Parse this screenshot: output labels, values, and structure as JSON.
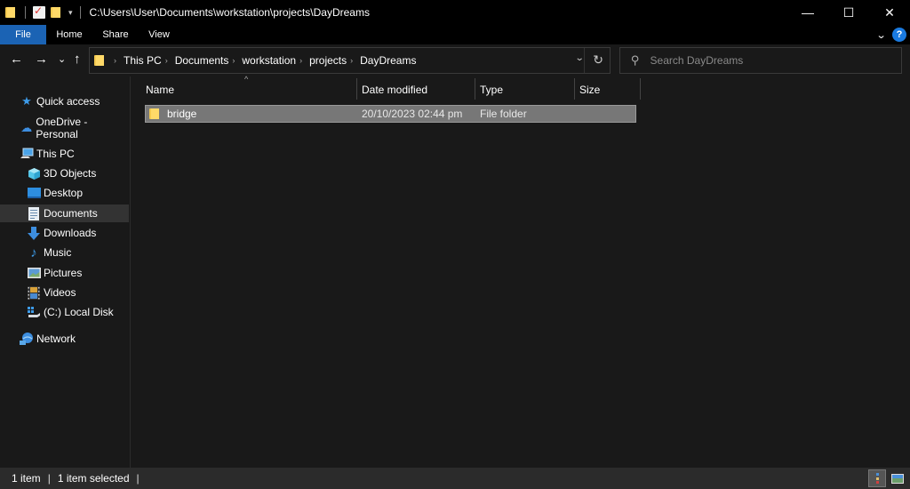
{
  "window": {
    "title": "C:\\Users\\User\\Documents\\workstation\\projects\\DayDreams",
    "controls": {
      "minimize": "—",
      "maximize": "☐",
      "close": "✕"
    }
  },
  "quick_access_toolbar": {
    "icons": [
      "folder-icon",
      "properties-icon",
      "new-folder-icon",
      "customize-dropdown-icon"
    ],
    "dropdown_glyph": "▾"
  },
  "ribbon": {
    "tabs": [
      {
        "label": "File",
        "active": true
      },
      {
        "label": "Home"
      },
      {
        "label": "Share"
      },
      {
        "label": "View"
      }
    ],
    "expand_glyph": "⌄",
    "help_glyph": "?",
    "file_tab_color": "#1b63b4"
  },
  "navigation": {
    "back_glyph": "←",
    "forward_glyph": "→",
    "recent_glyph": "⌄",
    "up_glyph": "↑",
    "breadcrumb": [
      "This PC",
      "Documents",
      "workstation",
      "projects",
      "DayDreams"
    ],
    "crumb_separator": "›",
    "dropdown_glyph": "⌄",
    "refresh_glyph": "↻"
  },
  "search": {
    "placeholder": "Search DayDreams",
    "icon_glyph": "⚲"
  },
  "sidebar": {
    "items": [
      {
        "label": "Quick access",
        "icon": "star-icon",
        "glyph": "★",
        "color": "#3d9be9"
      },
      {
        "label": "OneDrive - Personal",
        "icon": "cloud-icon",
        "glyph": "☁",
        "color": "#3d8ee0"
      },
      {
        "label": "This PC",
        "icon": "computer-icon",
        "glyph": "🖳",
        "color": "#4aa3e8"
      },
      {
        "label": "3D Objects",
        "icon": "cube-icon",
        "glyph": "◆",
        "color": "#53c6e8"
      },
      {
        "label": "Desktop",
        "icon": "desktop-icon",
        "glyph": "▬",
        "color": "#2d8ee0"
      },
      {
        "label": "Documents",
        "icon": "document-icon",
        "glyph": "▤",
        "color": "#dde5ee",
        "selected": true
      },
      {
        "label": "Downloads",
        "icon": "download-arrow-icon",
        "glyph": "⬇",
        "color": "#3d8ee0"
      },
      {
        "label": "Music",
        "icon": "music-note-icon",
        "glyph": "♪",
        "color": "#3d9be9"
      },
      {
        "label": "Pictures",
        "icon": "pictures-icon",
        "glyph": "▭",
        "color": "#8fb8d8"
      },
      {
        "label": "Videos",
        "icon": "film-icon",
        "glyph": "▦",
        "color": "#c88a3a"
      },
      {
        "label": "(C:) Local Disk",
        "icon": "disk-icon",
        "glyph": "▭",
        "color": "#cfd6dd"
      },
      {
        "label": "Network",
        "icon": "network-icon",
        "glyph": "◉",
        "color": "#3d8ee0"
      }
    ]
  },
  "file_list": {
    "columns": [
      "Name",
      "Date modified",
      "Type",
      "Size"
    ],
    "sort_glyph": "^",
    "rows": [
      {
        "name": "bridge",
        "date_modified": "20/10/2023 02:44 pm",
        "type": "File folder",
        "size": "",
        "selected": true
      }
    ]
  },
  "status_bar": {
    "item_count": "1 item",
    "selection": "1 item selected",
    "separator": "|",
    "view_modes": [
      "details-view",
      "large-icons-view"
    ]
  }
}
